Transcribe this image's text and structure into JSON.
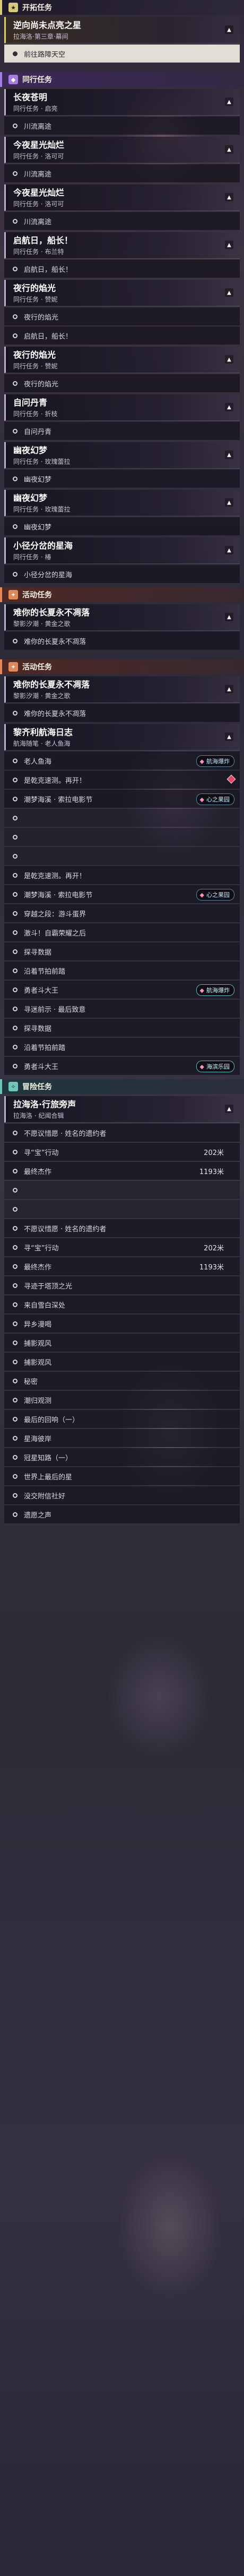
{
  "sections": {
    "trailblaze": {
      "title": "开拓任务"
    },
    "companion1": {
      "title": "同行任务"
    },
    "event1": {
      "title": "活动任务"
    },
    "event2": {
      "title": "活动任务"
    },
    "adventure": {
      "title": "冒险任务"
    }
  },
  "quests": {
    "q1": {
      "title": "逆向尚未点亮之星",
      "sub": "拉海洛·第三章·幕间",
      "obj": "前往路障天空"
    },
    "q2": {
      "title": "长夜苍明",
      "sub": "同行任务 · 启亮",
      "obj": "川流离途"
    },
    "q3": {
      "title": "今夜星光灿烂",
      "sub": "同行任务 · 洛可可",
      "obj": "川流离途"
    },
    "q4": {
      "title": "今夜星光灿烂",
      "sub": "同行任务 · 洛可可",
      "obj": "川流离途"
    },
    "q5": {
      "title": "启航日，船长！",
      "sub": "同行任务 · 布兰特",
      "obj": "启航日，船长！"
    },
    "q6": {
      "title": "夜行的焰光",
      "sub": "同行任务 · 赞妮",
      "obj1": "夜行的焰光",
      "obj2": "启航日，船长！"
    },
    "q7": {
      "title": "夜行的焰光",
      "sub": "同行任务 · 赞妮",
      "obj": "夜行的焰光"
    },
    "q8": {
      "title": "自问丹青",
      "sub": "同行任务 · 折枝",
      "obj": "自问丹青"
    },
    "q9": {
      "title": "幽夜幻梦",
      "sub": "同行任务 · 玫瑰蕾拉",
      "obj": "幽夜幻梦"
    },
    "q10": {
      "title": "幽夜幻梦",
      "sub": "同行任务 · 玫瑰蕾拉",
      "obj": "幽夜幻梦"
    },
    "q11": {
      "title": "小径分岔的星海",
      "sub": "同行任务 · 椿",
      "obj": "小径分岔的星海"
    },
    "q12": {
      "title": "难你的长夏永不凋落",
      "sub": "黎影汐潮 · 黄金之歌",
      "obj": "难你的长夏永不凋落"
    },
    "q13": {
      "title": "难你的长夏永不凋落",
      "sub": "黎影汐潮 · 黄金之歌",
      "obj": "难你的长夏永不凋落"
    },
    "q14": {
      "title": "黎齐利航海日志",
      "sub": "航海随笔 · 老人鱼海",
      "objs": [
        "老人鱼海",
        "是乾克速测。再开！",
        "潮梦海溪 · 索拉电影节",
        "是乾克速测。再开！",
        "潮梦海溪 · 索拉电影节",
        "穿越之段：游斗蛋界",
        "激斗！自霸荣耀之后",
        "探寻数据",
        "沿着节拍前踏",
        "勇者斗大王",
        "寻迷前示 · 最后致意",
        "探寻数据",
        "沿着节拍前踏",
        "勇者斗大王"
      ]
    },
    "q15": {
      "title": "拉海洛·行旅旁声",
      "sub": "拉海洛 · 纪闻合辑",
      "objs": [
        "不愿议惜愿 · 姓名的遗约者",
        "寻“宝”行动",
        "最终杰作",
        "不愿议惜愿 · 姓名的遗约者",
        "寻“宝”行动",
        "最终杰作",
        "寻迹于塔顶之光",
        "来自雪白深处",
        "异乡漫喝",
        "捕影观风",
        "捕影观风",
        "秘密",
        "潮归观测",
        "最后的回响（一）",
        "星海彼岸",
        "冠星知路（一）",
        "世界上最后的星",
        "没交附信社好",
        "遗愿之声"
      ],
      "distances": {
        "d1": "202米",
        "d2": "1193米",
        "d3": "202米",
        "d4": "1193米"
      }
    }
  },
  "badges": {
    "b1": "航海爆炸",
    "b2": "心之果园",
    "b3": "心之果园",
    "b4": "航海爆炸",
    "b5": "海滨乐园"
  }
}
